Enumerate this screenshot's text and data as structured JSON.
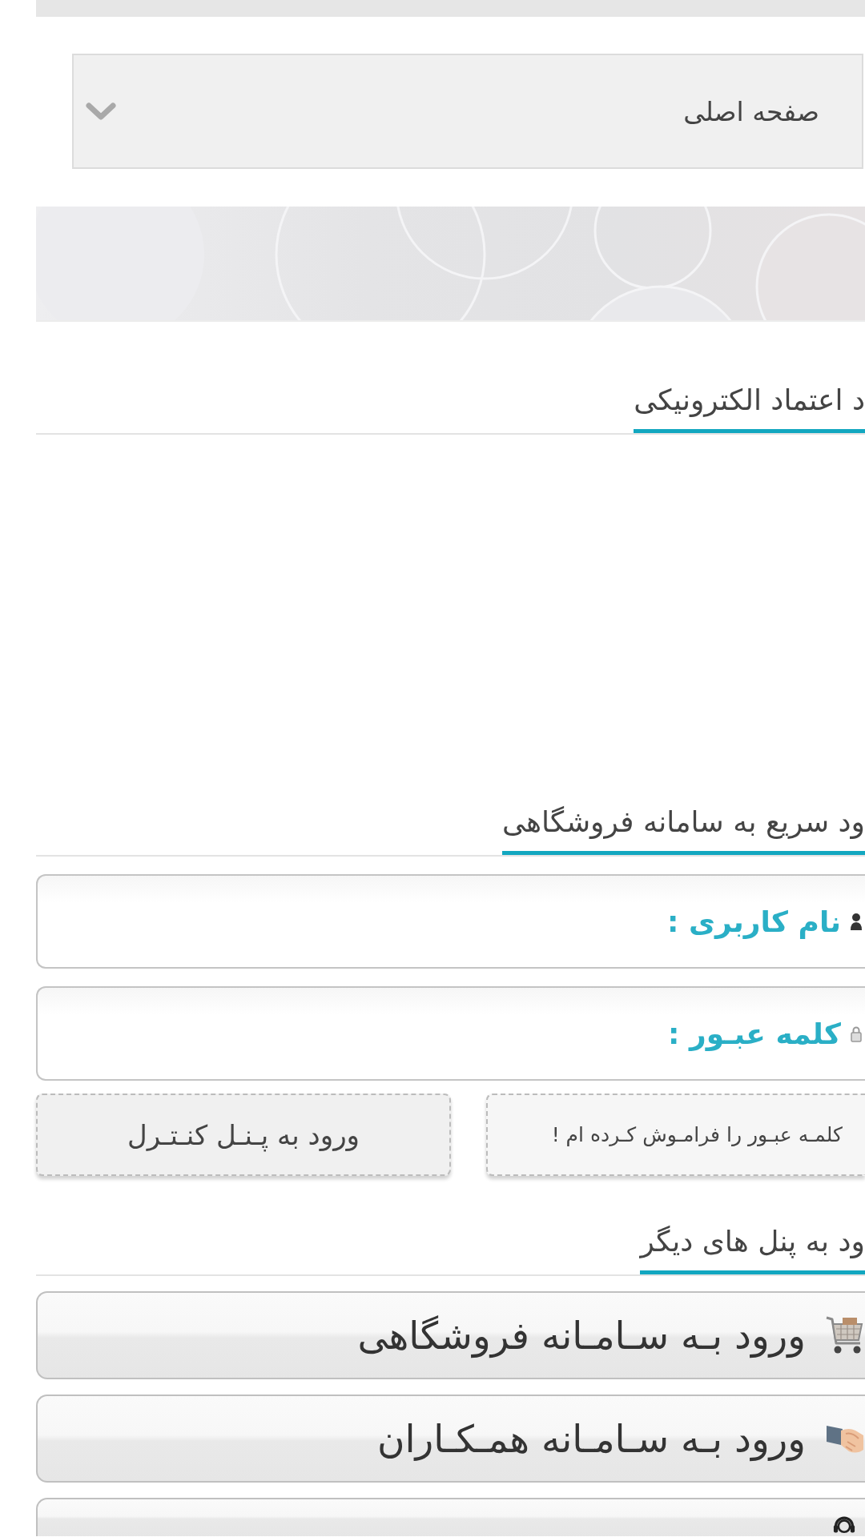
{
  "nav_select": {
    "value": "صفحه اصلی"
  },
  "trust_section": {
    "title": "د اعتماد الکترونیکی"
  },
  "quick_login": {
    "title": "ود سریع به سامانه فروشگاهی",
    "fields": [
      {
        "kind": "username",
        "label": "نام کاربری :"
      },
      {
        "kind": "password",
        "label": "کلمه عبـور :"
      }
    ],
    "forgot_button": "کلمـه عبـور را فرامـوش کـرده ام !",
    "login_button": "ورود به پـنـل کنـتـرل"
  },
  "other_panels": {
    "title": "ود به پنل های دیگر",
    "buttons": [
      {
        "kind": "cart",
        "label": "ورود بـه سـامـانه فروشگاهی"
      },
      {
        "kind": "handshake",
        "label": "ورود بـه سـامـانه همـکـاران"
      },
      {
        "kind": "headset"
      }
    ]
  }
}
